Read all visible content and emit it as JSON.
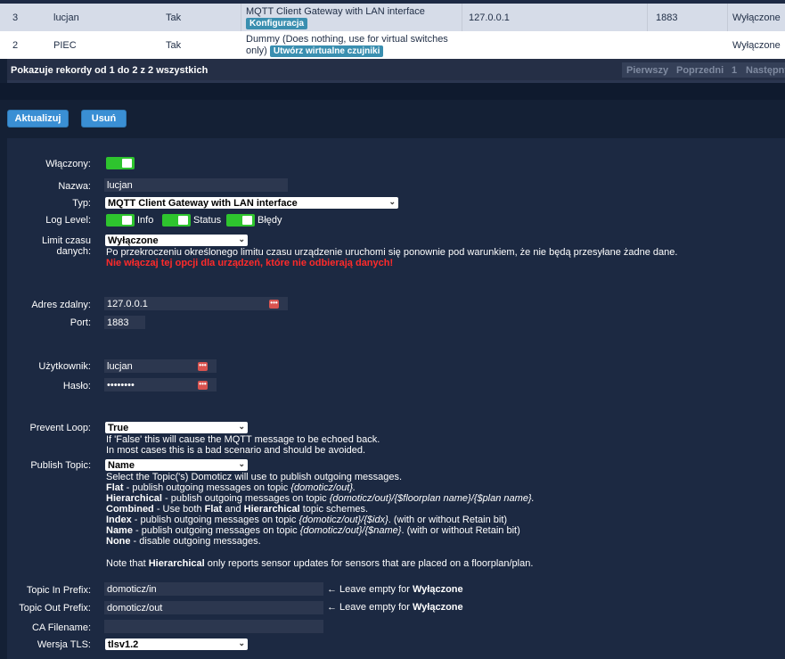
{
  "table": {
    "rows": [
      {
        "idx": "3",
        "name": "lucjan",
        "enabled": "Tak",
        "type": "MQTT Client Gateway with LAN interface",
        "action": "Konfiguracja",
        "address": "127.0.0.1",
        "port": "1883",
        "status": "Wyłączone"
      },
      {
        "idx": "2",
        "name": "PIEC",
        "enabled": "Tak",
        "type": "Dummy (Does nothing, use for virtual switches only)",
        "type_line1": "Dummy (Does nothing, use for virtual switches",
        "type_line2": "only)",
        "action": "Utwórz wirtualne czujniki",
        "address": "",
        "port": "",
        "status": "Wyłączone"
      }
    ],
    "footer_info": "Pokazuje rekordy od 1 do 2 z 2 wszystkich",
    "pager": {
      "first": "Pierwszy",
      "prev": "Poprzedni",
      "page": "1",
      "next": "Następny"
    }
  },
  "buttons": {
    "update": "Aktualizuj",
    "delete": "Usuń"
  },
  "form": {
    "enabled_label": "Włączony:",
    "name_label": "Nazwa:",
    "name_value": "lucjan",
    "type_label": "Typ:",
    "type_value": "MQTT Client Gateway with LAN interface",
    "loglevel_label": "Log Level:",
    "log_info": "Info",
    "log_status": "Status",
    "log_errors": "Błędy",
    "timeout_label_1": "Limit czasu",
    "timeout_label_2": "danych:",
    "timeout_value": "Wyłączone",
    "timeout_help": "Po przekroczeniu określonego limitu czasu urządzenie uruchomi się ponownie pod warunkiem, że nie będą przesyłane żadne dane.",
    "timeout_warning": "Nie włączaj tej opcji dla urządzeń, które nie odbierają danych!",
    "address_label": "Adres zdalny:",
    "address_value": "127.0.0.1",
    "port_label": "Port:",
    "port_value": "1883",
    "user_label": "Użytkownik:",
    "user_value": "lucjan",
    "password_label": "Hasło:",
    "password_value": "••••••••",
    "prevent_loop_label": "Prevent Loop:",
    "prevent_loop_value": "True",
    "prevent_loop_help_1": "If 'False' this will cause the MQTT message to be echoed back.",
    "prevent_loop_help_2": "In most cases this is a bad scenario and should be avoided.",
    "publish_topic_label": "Publish Topic:",
    "publish_topic_value": "Name",
    "pt_help_intro": "Select the Topic('s) Domoticz will use to publish outgoing messages.",
    "pt_flat_b": "Flat",
    "pt_flat_t": " - publish outgoing messages on topic ",
    "pt_flat_i": "{domoticz/out}.",
    "pt_hier_b": "Hierarchical",
    "pt_hier_t": " - publish outgoing messages on topic ",
    "pt_hier_i": "{domoticz/out}/{$floorplan name}/{$plan name}.",
    "pt_comb_b": "Combined",
    "pt_comb_t1": " - Use both ",
    "pt_comb_b2": "Flat",
    "pt_comb_t2": " and ",
    "pt_comb_b3": "Hierarchical",
    "pt_comb_t3": " topic schemes.",
    "pt_index_b": "Index",
    "pt_index_t": " - publish outgoing messages on topic ",
    "pt_index_i": "{domoticz/out}/{$idx}",
    "pt_index_t2": ". (with or without Retain bit)",
    "pt_name_b": "Name",
    "pt_name_t": " - publish outgoing messages on topic ",
    "pt_name_i": "{domoticz/out}/{$name}",
    "pt_name_t2": ". (with or without Retain bit)",
    "pt_none_b": "None",
    "pt_none_t": " - disable outgoing messages.",
    "pt_note_t1": "Note that ",
    "pt_note_b": "Hierarchical",
    "pt_note_t2": " only reports sensor updates for sensors that are placed on a floorplan/plan.",
    "topic_in_label": "Topic In Prefix:",
    "topic_in_value": "domoticz/in",
    "topic_out_label": "Topic Out Prefix:",
    "topic_out_value": "domoticz/out",
    "leave_empty": "← Leave empty for ",
    "leave_empty_b": "Wyłączone",
    "ca_label": "CA Filename:",
    "ca_value": "",
    "tls_label": "Wersja TLS:",
    "tls_value": "tlsv1.2"
  },
  "colors": {
    "toggle_on": "#2ec42e",
    "button": "#3a8fd4",
    "badge": "#3a8fb0",
    "warning": "#ff2a2a"
  }
}
